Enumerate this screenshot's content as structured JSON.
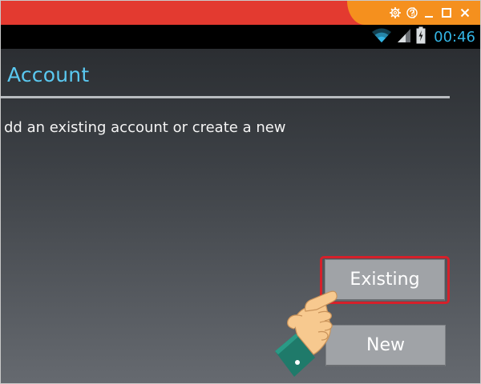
{
  "emulator": {
    "controls": [
      {
        "icon": "gear-icon"
      },
      {
        "icon": "help-icon"
      },
      {
        "icon": "minimize-icon"
      },
      {
        "icon": "maximize-icon"
      },
      {
        "icon": "close-icon"
      }
    ],
    "bar_color": "#e33a30",
    "controls_color": "#f5901e"
  },
  "status_bar": {
    "time": "00:46",
    "icons": [
      "wifi-icon",
      "signal-icon",
      "battery-charging-icon"
    ],
    "accent": "#33b5e5"
  },
  "screen": {
    "title": "Account",
    "description": "dd an existing account or create a new",
    "buttons": {
      "existing": "Existing",
      "new": "New"
    },
    "title_color": "#5ac8f0",
    "highlight_color": "#d6202a"
  }
}
